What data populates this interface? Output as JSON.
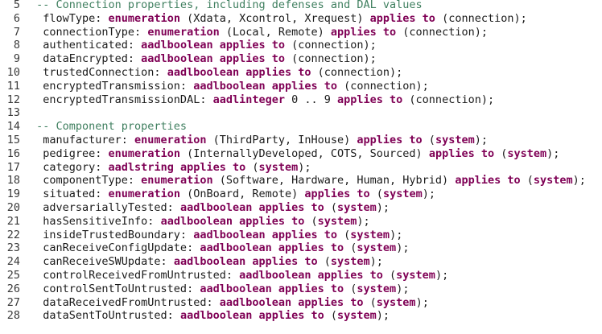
{
  "colors": {
    "comment": "#3f7f5f",
    "keyword": "#7f0055",
    "text": "#1a1a1a",
    "line_number": "#3a3a3a"
  },
  "lines": [
    {
      "num": "5",
      "tokens": [
        {
          "t": "c",
          "s": " -- Connection properties, including defenses and DAL values"
        }
      ]
    },
    {
      "num": "6",
      "tokens": [
        {
          "t": "p",
          "s": "  flowType: "
        },
        {
          "t": "k",
          "s": "enumeration"
        },
        {
          "t": "p",
          "s": " (Xdata, Xcontrol, Xrequest) "
        },
        {
          "t": "k",
          "s": "applies to"
        },
        {
          "t": "p",
          "s": " (connection);"
        }
      ]
    },
    {
      "num": "7",
      "tokens": [
        {
          "t": "p",
          "s": "  connectionType: "
        },
        {
          "t": "k",
          "s": "enumeration"
        },
        {
          "t": "p",
          "s": " (Local, Remote) "
        },
        {
          "t": "k",
          "s": "applies to"
        },
        {
          "t": "p",
          "s": " (connection);"
        }
      ]
    },
    {
      "num": "8",
      "tokens": [
        {
          "t": "p",
          "s": "  authenticated: "
        },
        {
          "t": "k",
          "s": "aadlboolean applies to"
        },
        {
          "t": "p",
          "s": " (connection);"
        }
      ]
    },
    {
      "num": "9",
      "tokens": [
        {
          "t": "p",
          "s": "  dataEncrypted: "
        },
        {
          "t": "k",
          "s": "aadlboolean applies to"
        },
        {
          "t": "p",
          "s": " (connection);"
        }
      ]
    },
    {
      "num": "10",
      "tokens": [
        {
          "t": "p",
          "s": "  trustedConnection: "
        },
        {
          "t": "k",
          "s": "aadlboolean applies to"
        },
        {
          "t": "p",
          "s": " (connection);"
        }
      ]
    },
    {
      "num": "11",
      "tokens": [
        {
          "t": "p",
          "s": "  encryptedTransmission: "
        },
        {
          "t": "k",
          "s": "aadlboolean applies to"
        },
        {
          "t": "p",
          "s": " (connection);"
        }
      ]
    },
    {
      "num": "12",
      "tokens": [
        {
          "t": "p",
          "s": "  encryptedTransmissionDAL: "
        },
        {
          "t": "k",
          "s": "aadlinteger"
        },
        {
          "t": "p",
          "s": " 0 .. 9 "
        },
        {
          "t": "k",
          "s": "applies to"
        },
        {
          "t": "p",
          "s": " (connection);"
        }
      ]
    },
    {
      "num": "13",
      "tokens": []
    },
    {
      "num": "14",
      "tokens": [
        {
          "t": "c",
          "s": " -- Component properties"
        }
      ]
    },
    {
      "num": "15",
      "tokens": [
        {
          "t": "p",
          "s": "  manufacturer: "
        },
        {
          "t": "k",
          "s": "enumeration"
        },
        {
          "t": "p",
          "s": " (ThirdParty, InHouse) "
        },
        {
          "t": "k",
          "s": "applies to"
        },
        {
          "t": "p",
          "s": " ("
        },
        {
          "t": "k",
          "s": "system"
        },
        {
          "t": "p",
          "s": ");"
        }
      ]
    },
    {
      "num": "16",
      "tokens": [
        {
          "t": "p",
          "s": "  pedigree: "
        },
        {
          "t": "k",
          "s": "enumeration"
        },
        {
          "t": "p",
          "s": " (InternallyDeveloped, COTS, Sourced) "
        },
        {
          "t": "k",
          "s": "applies to"
        },
        {
          "t": "p",
          "s": " ("
        },
        {
          "t": "k",
          "s": "system"
        },
        {
          "t": "p",
          "s": ");"
        }
      ]
    },
    {
      "num": "17",
      "tokens": [
        {
          "t": "p",
          "s": "  category: "
        },
        {
          "t": "k",
          "s": "aadlstring applies to"
        },
        {
          "t": "p",
          "s": " ("
        },
        {
          "t": "k",
          "s": "system"
        },
        {
          "t": "p",
          "s": ");"
        }
      ]
    },
    {
      "num": "18",
      "tokens": [
        {
          "t": "p",
          "s": "  componentType: "
        },
        {
          "t": "k",
          "s": "enumeration"
        },
        {
          "t": "p",
          "s": " (Software, Hardware, Human, Hybrid) "
        },
        {
          "t": "k",
          "s": "applies to"
        },
        {
          "t": "p",
          "s": " ("
        },
        {
          "t": "k",
          "s": "system"
        },
        {
          "t": "p",
          "s": ");"
        }
      ]
    },
    {
      "num": "19",
      "tokens": [
        {
          "t": "p",
          "s": "  situated: "
        },
        {
          "t": "k",
          "s": "enumeration"
        },
        {
          "t": "p",
          "s": " (OnBoard, Remote) "
        },
        {
          "t": "k",
          "s": "applies to"
        },
        {
          "t": "p",
          "s": " ("
        },
        {
          "t": "k",
          "s": "system"
        },
        {
          "t": "p",
          "s": ");"
        }
      ]
    },
    {
      "num": "20",
      "tokens": [
        {
          "t": "p",
          "s": "  adversariallyTested: "
        },
        {
          "t": "k",
          "s": "aadlboolean applies to"
        },
        {
          "t": "p",
          "s": " ("
        },
        {
          "t": "k",
          "s": "system"
        },
        {
          "t": "p",
          "s": ");"
        }
      ]
    },
    {
      "num": "21",
      "tokens": [
        {
          "t": "p",
          "s": "  hasSensitiveInfo: "
        },
        {
          "t": "k",
          "s": "aadlboolean applies to"
        },
        {
          "t": "p",
          "s": " ("
        },
        {
          "t": "k",
          "s": "system"
        },
        {
          "t": "p",
          "s": ");"
        }
      ]
    },
    {
      "num": "22",
      "tokens": [
        {
          "t": "p",
          "s": "  insideTrustedBoundary: "
        },
        {
          "t": "k",
          "s": "aadlboolean applies to"
        },
        {
          "t": "p",
          "s": " ("
        },
        {
          "t": "k",
          "s": "system"
        },
        {
          "t": "p",
          "s": ");"
        }
      ]
    },
    {
      "num": "23",
      "tokens": [
        {
          "t": "p",
          "s": "  canReceiveConfigUpdate: "
        },
        {
          "t": "k",
          "s": "aadlboolean applies to"
        },
        {
          "t": "p",
          "s": " ("
        },
        {
          "t": "k",
          "s": "system"
        },
        {
          "t": "p",
          "s": ");"
        }
      ]
    },
    {
      "num": "24",
      "tokens": [
        {
          "t": "p",
          "s": "  canReceiveSWUpdate: "
        },
        {
          "t": "k",
          "s": "aadlboolean applies to"
        },
        {
          "t": "p",
          "s": " ("
        },
        {
          "t": "k",
          "s": "system"
        },
        {
          "t": "p",
          "s": ");"
        }
      ]
    },
    {
      "num": "25",
      "tokens": [
        {
          "t": "p",
          "s": "  controlReceivedFromUntrusted: "
        },
        {
          "t": "k",
          "s": "aadlboolean applies to"
        },
        {
          "t": "p",
          "s": " ("
        },
        {
          "t": "k",
          "s": "system"
        },
        {
          "t": "p",
          "s": ");"
        }
      ]
    },
    {
      "num": "26",
      "tokens": [
        {
          "t": "p",
          "s": "  controlSentToUntrusted: "
        },
        {
          "t": "k",
          "s": "aadlboolean applies to"
        },
        {
          "t": "p",
          "s": " ("
        },
        {
          "t": "k",
          "s": "system"
        },
        {
          "t": "p",
          "s": ");"
        }
      ]
    },
    {
      "num": "27",
      "tokens": [
        {
          "t": "p",
          "s": "  dataReceivedFromUntrusted: "
        },
        {
          "t": "k",
          "s": "aadlboolean applies to"
        },
        {
          "t": "p",
          "s": " ("
        },
        {
          "t": "k",
          "s": "system"
        },
        {
          "t": "p",
          "s": ");"
        }
      ]
    },
    {
      "num": "28",
      "tokens": [
        {
          "t": "p",
          "s": "  dataSentToUntrusted: "
        },
        {
          "t": "k",
          "s": "aadlboolean applies to"
        },
        {
          "t": "p",
          "s": " ("
        },
        {
          "t": "k",
          "s": "system"
        },
        {
          "t": "p",
          "s": ");"
        }
      ]
    }
  ]
}
